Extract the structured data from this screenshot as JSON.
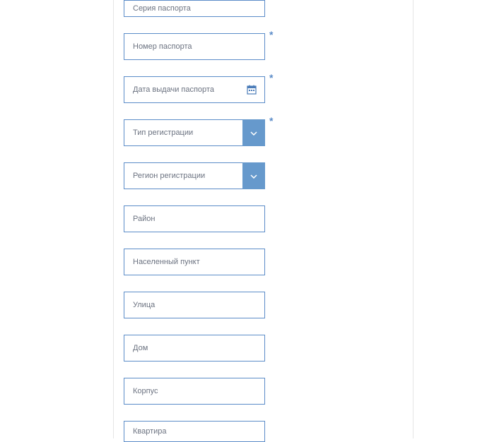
{
  "fields": {
    "passport_series": {
      "placeholder": "Серия паспорта",
      "required_mark": ""
    },
    "passport_number": {
      "placeholder": "Номер паспорта",
      "required_mark": "*"
    },
    "passport_issue_date": {
      "placeholder": "Дата выдачи паспорта",
      "required_mark": "*"
    },
    "registration_type": {
      "placeholder": "Тип регистрации",
      "required_mark": "*"
    },
    "registration_region": {
      "placeholder": "Регион регистрации",
      "required_mark": ""
    },
    "district": {
      "placeholder": "Район",
      "required_mark": ""
    },
    "locality": {
      "placeholder": "Населенный пункт",
      "required_mark": ""
    },
    "street": {
      "placeholder": "Улица",
      "required_mark": ""
    },
    "house": {
      "placeholder": "Дом",
      "required_mark": ""
    },
    "building": {
      "placeholder": "Корпус",
      "required_mark": ""
    },
    "apartment": {
      "placeholder": "Квартира",
      "required_mark": ""
    }
  }
}
